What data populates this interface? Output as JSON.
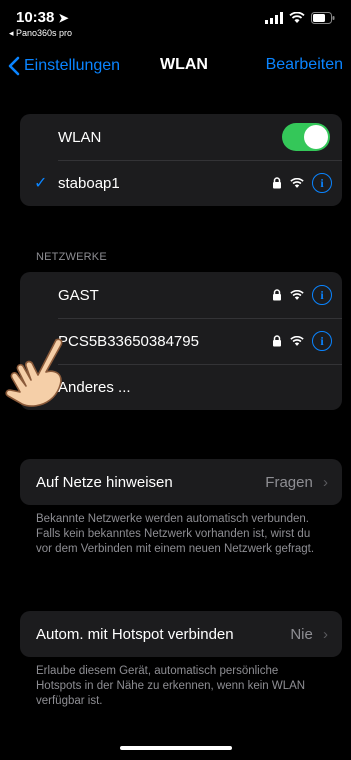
{
  "status": {
    "time": "10:38",
    "back_app": "◂ Pano360s pro"
  },
  "nav": {
    "back_label": "Einstellungen",
    "title": "WLAN",
    "edit_label": "Bearbeiten"
  },
  "wlan_card": {
    "toggle_label": "WLAN",
    "toggle_on": true,
    "connected_network": "staboap1"
  },
  "networks": {
    "header": "NETZWERKE",
    "items": [
      {
        "name": "GAST"
      },
      {
        "name": "PCS5B33650384795"
      },
      {
        "name": "Anderes ..."
      }
    ]
  },
  "ask_to_join": {
    "label": "Auf Netze hinweisen",
    "value": "Fragen",
    "footnote": "Bekannte Netzwerke werden automatisch verbunden. Falls kein bekanntes Netzwerk vorhanden ist, wirst du vor dem Verbinden mit einem neuen Netzwerk gefragt."
  },
  "hotspot": {
    "label": "Autom. mit Hotspot verbinden",
    "value": "Nie",
    "footnote": "Erlaube diesem Gerät, automatisch persönliche Hotspots in der Nähe zu erkennen, wenn kein WLAN verfügbar ist."
  },
  "colors": {
    "accent": "#0a84ff",
    "toggle_on": "#34c759",
    "card_bg": "#1c1c1e",
    "secondary_text": "#8e8e93"
  }
}
